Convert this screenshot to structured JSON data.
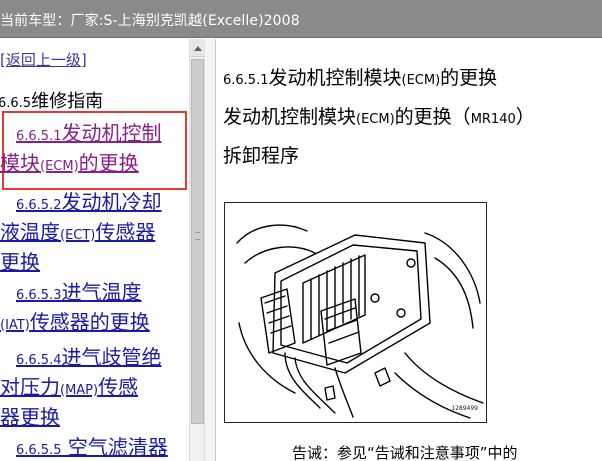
{
  "window": {
    "title": "当前车型：厂家:S-上海别克凯越(Excelle)2008"
  },
  "left_pane": {
    "back_link": "[返回上一级]",
    "section_heading_num": "6.6.5",
    "section_heading_text": "维修指南",
    "items": [
      {
        "num": "6.6.5.1",
        "line1": "发动机控制",
        "line2_pre": "模块",
        "line2_abbr": "(ECM)",
        "line2_post": "的更换"
      },
      {
        "num": "6.6.5.2",
        "line1": "发动机冷却",
        "line2_pre": "液温度",
        "line2_abbr": "(ECT)",
        "line2_post": "传感器",
        "line3": "更换"
      },
      {
        "num": "6.6.5.3",
        "line1": "进气温度",
        "line2_abbr": "(IAT)",
        "line2_post": "传感器的更换"
      },
      {
        "num": "6.6.5.4",
        "line1": "进气歧管绝",
        "line2_pre": "对压力",
        "line2_abbr": "(MAP)",
        "line2_post": "传感",
        "line3": "器更换"
      },
      {
        "num": "6.6.5.5",
        "line1": " 空气滤清器"
      }
    ]
  },
  "right_pane": {
    "title_num": "6.6.5.1",
    "title_pre": "发动机控制模块",
    "title_abbr": "(ECM)",
    "title_post": "的更换",
    "subtitle_pre": "发动机控制模块",
    "subtitle_abbr": "(ECM)",
    "subtitle_mid": "的更换（",
    "subtitle_code": "MR140",
    "subtitle_post": "）",
    "procedure": "拆卸程序",
    "figure_id": "1289499",
    "warning": "告诫：参见“告诫和注意事项”中的"
  }
}
